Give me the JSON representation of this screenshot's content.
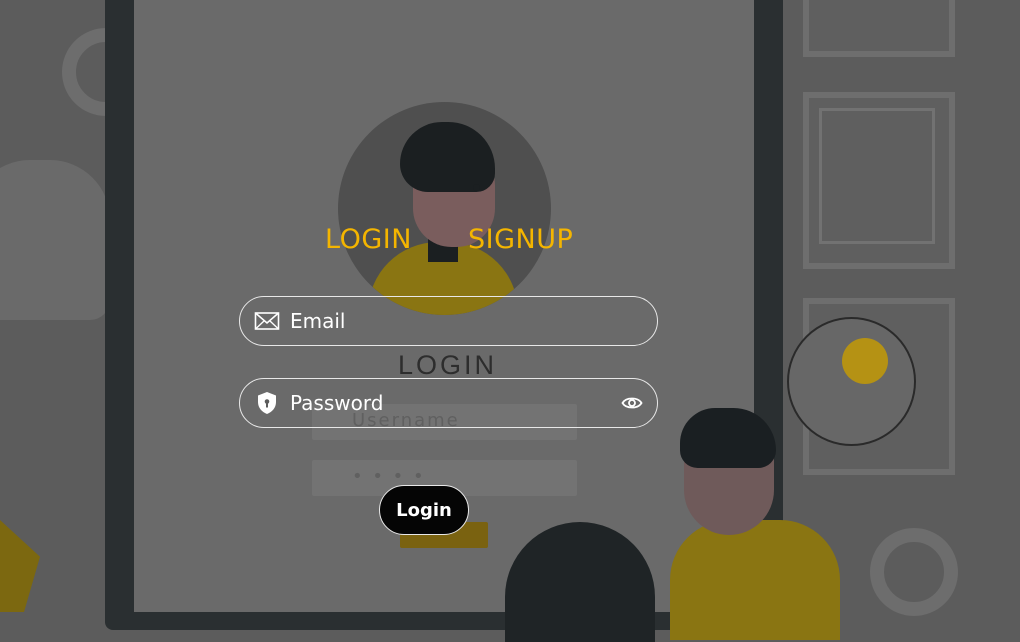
{
  "tabs": {
    "login": "LOGIN",
    "signup": "SIGNUP"
  },
  "form": {
    "email": {
      "placeholder": "Email",
      "value": ""
    },
    "password": {
      "placeholder": "Password",
      "value": ""
    },
    "submit_label": "Login"
  },
  "background": {
    "title": "LOGIN",
    "username_placeholder": "Username",
    "password_mask": "• • • •"
  },
  "icons": {
    "email": "envelope-icon",
    "password": "shield-lock-icon",
    "toggle": "eye-icon"
  },
  "colors": {
    "accent": "#f4b500",
    "overlay": "#5c5c5c",
    "button": "#050505",
    "border": "#e8e8e8"
  }
}
